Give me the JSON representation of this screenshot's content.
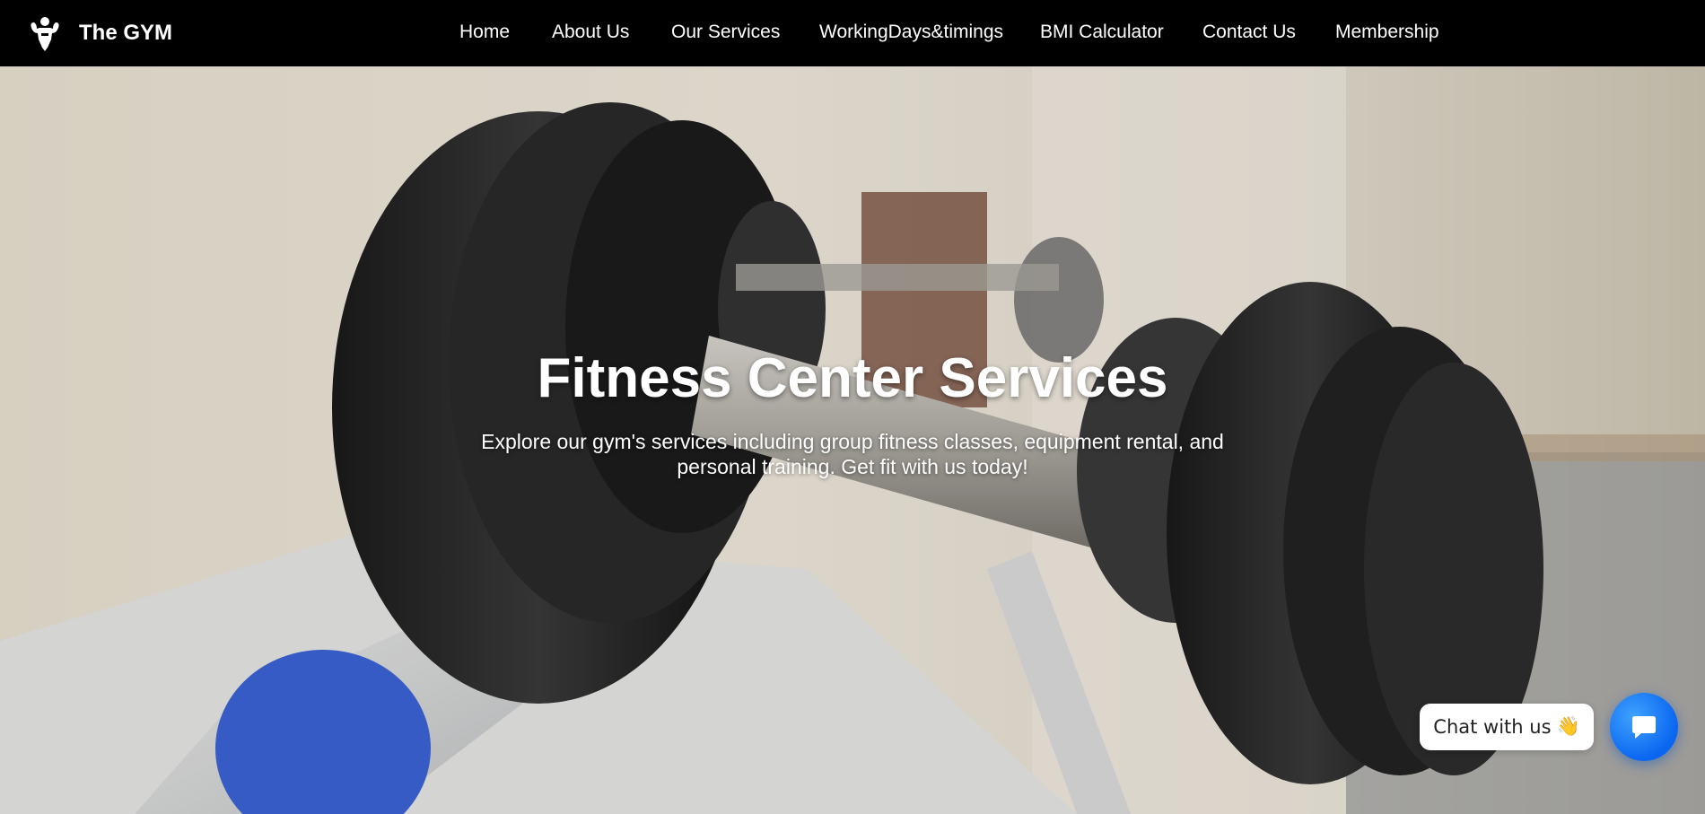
{
  "brand": {
    "name": "The GYM",
    "logo_icon": "muscle-man-icon"
  },
  "nav": {
    "items": [
      {
        "label": "Home"
      },
      {
        "label": "About Us"
      },
      {
        "label": "Our Services"
      },
      {
        "label": "WorkingDays&timings"
      },
      {
        "label": "BMI Calculator"
      },
      {
        "label": "Contact Us"
      },
      {
        "label": "Membership"
      }
    ]
  },
  "hero": {
    "title": "Fitness Center Services",
    "subtitle": "Explore our gym's services including group fitness classes, equipment rental, and personal training. Get fit with us today!",
    "background": "dumbbell-rack-photo"
  },
  "chat": {
    "label": "Chat with us",
    "wave_icon": "waving-hand-icon",
    "button_icon": "chat-bubble-icon",
    "accent": "#0a66f0"
  }
}
